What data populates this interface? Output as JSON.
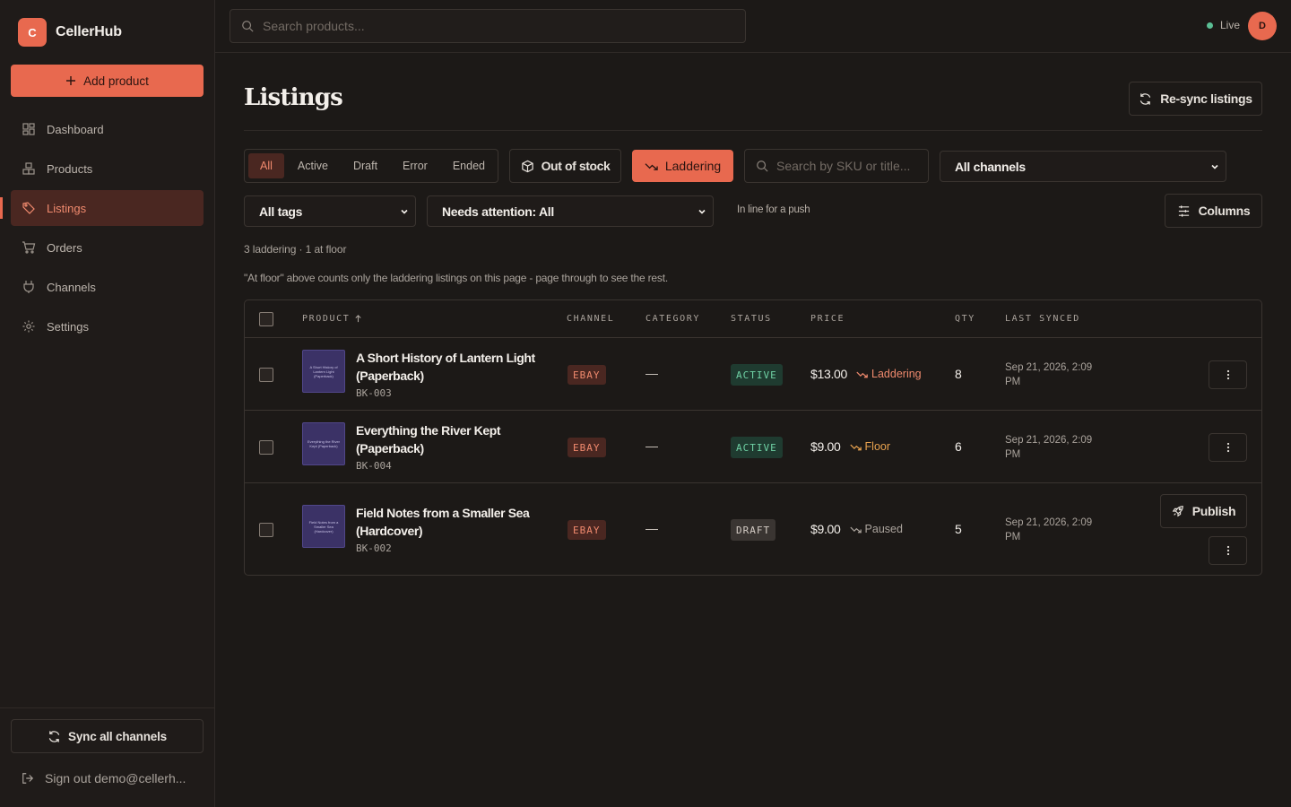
{
  "brand": {
    "logo_letter": "C",
    "name": "CellerHub"
  },
  "sidebar": {
    "add_product_label": "Add product",
    "items": [
      {
        "label": "Dashboard",
        "icon": "dashboard-icon"
      },
      {
        "label": "Products",
        "icon": "boxes-icon"
      },
      {
        "label": "Listings",
        "icon": "tag-icon",
        "active": true
      },
      {
        "label": "Orders",
        "icon": "cart-icon"
      },
      {
        "label": "Channels",
        "icon": "plug-icon"
      },
      {
        "label": "Settings",
        "icon": "gear-icon"
      }
    ],
    "sync_all_label": "Sync all channels",
    "signout_label": "Sign out demo@cellerh..."
  },
  "topbar": {
    "search_placeholder": "Search products...",
    "live_label": "Live",
    "avatar_letter": "D"
  },
  "page": {
    "title": "Listings",
    "resync_label": "Re-sync listings"
  },
  "filters": {
    "segments": [
      "All",
      "Active",
      "Draft",
      "Error",
      "Ended"
    ],
    "active_segment": "All",
    "out_of_stock_label": "Out of stock",
    "laddering_label": "Laddering",
    "sku_placeholder": "Search by SKU or title...",
    "channel_select": "All channels",
    "tags_select": "All tags",
    "attention_select": "Needs attention: All",
    "hint": "In line for a push",
    "columns_label": "Columns"
  },
  "summary": "3 laddering · 1 at floor",
  "note": "\"At floor\" above counts only the laddering listings on this page - page through to see the rest.",
  "table": {
    "headers": {
      "product": "PRODUCT",
      "channel": "CHANNEL",
      "category": "CATEGORY",
      "status": "STATUS",
      "price": "PRICE",
      "qty": "QTY",
      "last_synced": "LAST SYNCED"
    },
    "rows": [
      {
        "title_line1": "A Short History of Lantern Light",
        "title_line2": "(Paperback)",
        "thumb_text": "A Short History of Lantern Light (Paperback)",
        "sku": "BK-003",
        "channel": "EBAY",
        "category": "—",
        "status": "ACTIVE",
        "price": "$13.00",
        "price_state": "Laddering",
        "qty": "8",
        "synced_line1": "Sep 21, 2026, 2:09",
        "synced_line2": "PM"
      },
      {
        "title_line1": "Everything the River Kept",
        "title_line2": "(Paperback)",
        "thumb_text": "Everything the River Kept (Paperback)",
        "sku": "BK-004",
        "channel": "EBAY",
        "category": "—",
        "status": "ACTIVE",
        "price": "$9.00",
        "price_state": "Floor",
        "qty": "6",
        "synced_line1": "Sep 21, 2026, 2:09",
        "synced_line2": "PM"
      },
      {
        "title_line1": "Field Notes from a Smaller Sea",
        "title_line2": "(Hardcover)",
        "thumb_text": "Field Notes from a Smaller Sea (Hardcover)",
        "sku": "BK-002",
        "channel": "EBAY",
        "category": "—",
        "status": "DRAFT",
        "price": "$9.00",
        "price_state": "Paused",
        "qty": "5",
        "synced_line1": "Sep 21, 2026, 2:09",
        "synced_line2": "PM",
        "publish_label": "Publish"
      }
    ]
  },
  "colors": {
    "accent": "#e8694f",
    "laddering": "#f08a6e",
    "floor": "#e8a24f",
    "paused": "#aaa39c",
    "active_status": "#6fd1a4"
  }
}
